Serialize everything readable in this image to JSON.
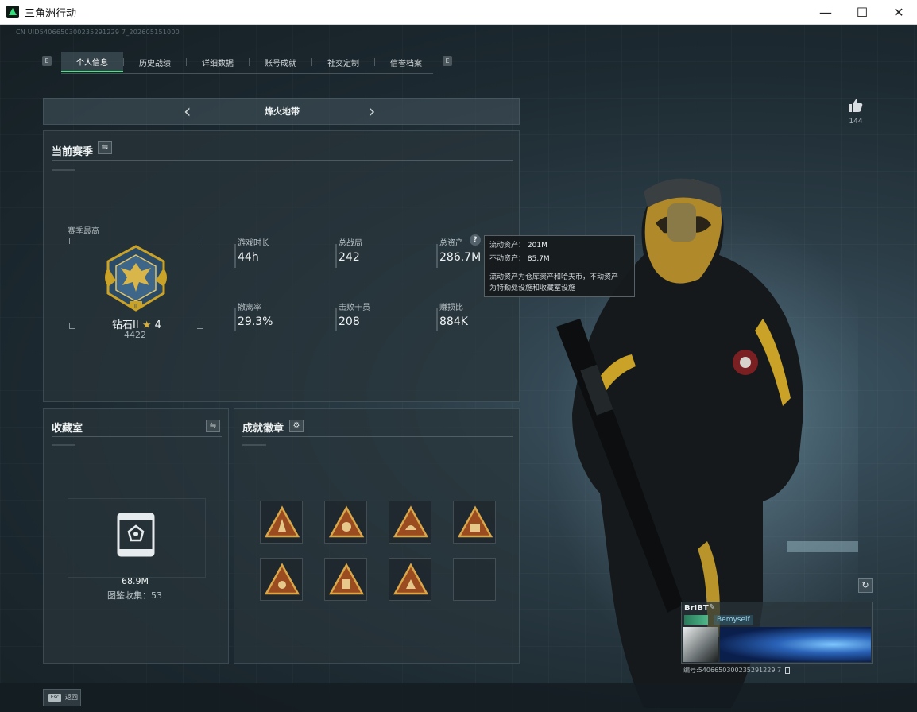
{
  "window": {
    "title": "三角洲行动",
    "controls": {
      "minimize": "—",
      "maximize": "☐",
      "close": "✕"
    }
  },
  "uid_line": "CN UID5406650300235291229 7_202605151000",
  "tabs": [
    {
      "label": "个人信息",
      "active": true
    },
    {
      "label": "历史战绩",
      "active": false
    },
    {
      "label": "详细数据",
      "active": false
    },
    {
      "label": "账号成就",
      "active": false
    },
    {
      "label": "社交定制",
      "active": false
    },
    {
      "label": "信誉档案",
      "active": false
    }
  ],
  "tab_nav": {
    "left": "E",
    "right": "E"
  },
  "mode_selector": {
    "title": "烽火地带",
    "prev": "‹",
    "next": "›"
  },
  "season": {
    "title": "当前赛季",
    "best_label": "赛季最高",
    "rank_name": "钻石II",
    "rank_stars": "4",
    "rank_score": "4422",
    "stats": [
      {
        "label": "游戏时长",
        "value": "44h"
      },
      {
        "label": "总战局",
        "value": "242"
      },
      {
        "label": "总资产",
        "value": "286.7M"
      },
      {
        "label": "撤离率",
        "value": "29.3%"
      },
      {
        "label": "击败干员",
        "value": "208"
      },
      {
        "label": "赚损比",
        "value": "884K"
      }
    ]
  },
  "tooltip": {
    "liquid_label": "流动资产：",
    "liquid_value": "201M",
    "fixed_label": "不动资产：",
    "fixed_value": "85.7M",
    "note_line1": "流动资产为仓库资产和哈夫币，不动资产",
    "note_line2": "为特勤处设施和收藏室设施"
  },
  "collection": {
    "title": "收藏室",
    "value": "68.9M",
    "count_label": "图鉴收集：",
    "count_value": "53"
  },
  "achievements": {
    "title": "成就徽章",
    "badges_filled": 7,
    "slots": 8
  },
  "likes": {
    "count": "144"
  },
  "player_card": {
    "name": "BrIBT",
    "title": "Bemyself",
    "number_label": "编号:",
    "number_value": "5406650300235291229 7"
  },
  "footer": {
    "key": "Esc",
    "label": "返回"
  },
  "colors": {
    "accent_green": "#59d98c",
    "gold": "#c9a227",
    "tooltip_bg": "#161a1c"
  }
}
